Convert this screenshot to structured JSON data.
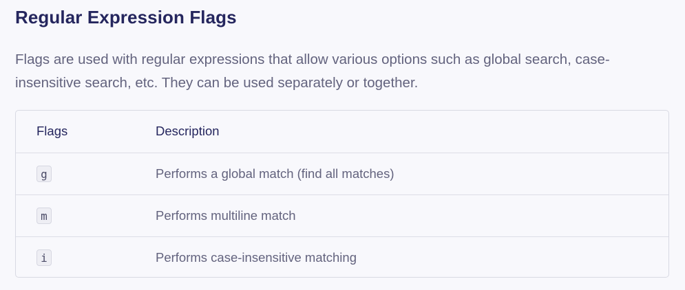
{
  "heading": "Regular Expression Flags",
  "intro": "Flags are used with regular expressions that allow various options such as global search, case-insensitive search, etc. They can be used separately or together.",
  "table": {
    "headers": [
      "Flags",
      "Description"
    ],
    "rows": [
      {
        "flag": "g",
        "description": "Performs a global match (find all matches)"
      },
      {
        "flag": "m",
        "description": "Performs multiline match"
      },
      {
        "flag": "i",
        "description": "Performs case-insensitive matching"
      }
    ]
  }
}
